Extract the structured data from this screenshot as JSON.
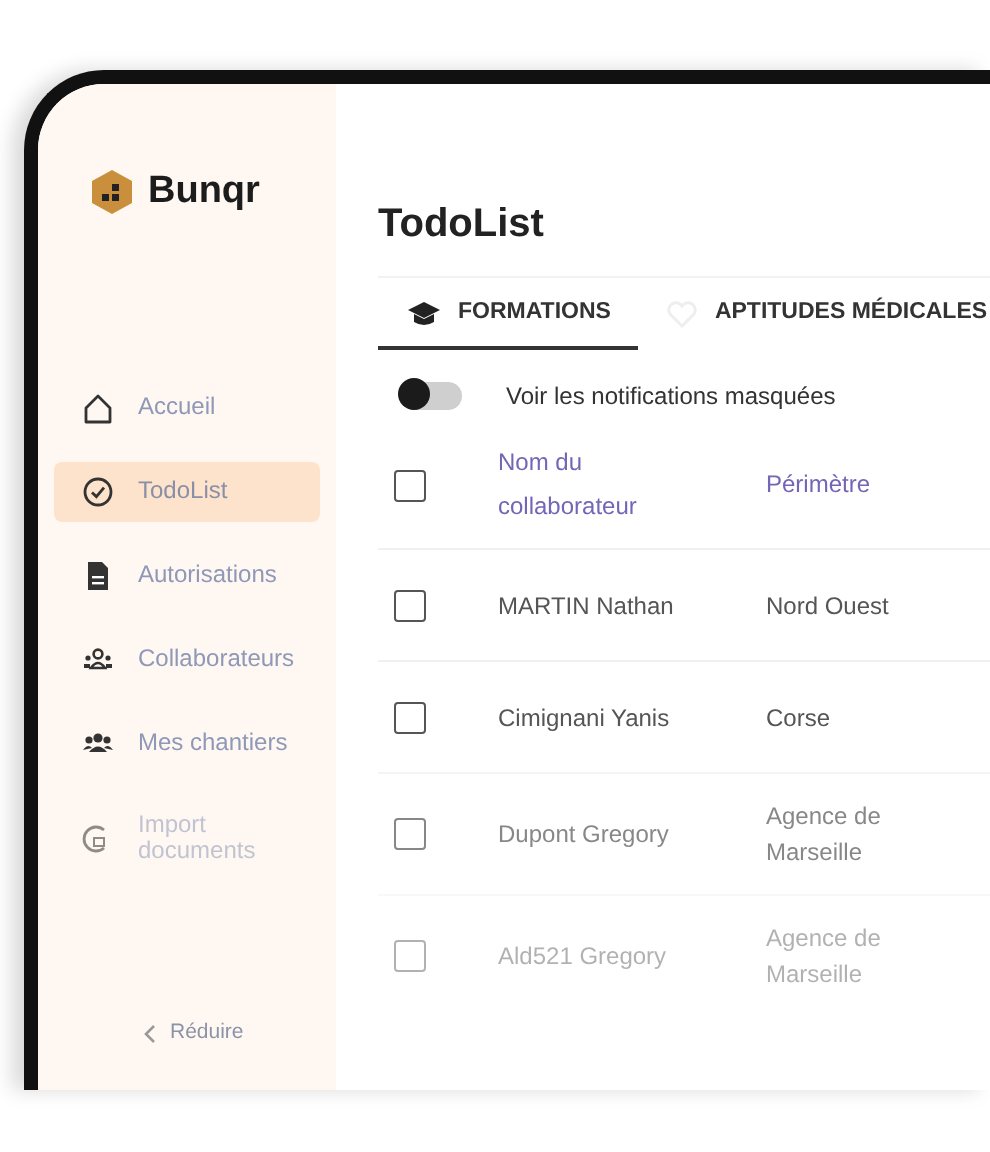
{
  "brand": {
    "name": "Bunqr"
  },
  "sidebar": {
    "items": [
      {
        "label": "Accueil",
        "kind": "home",
        "selected": false
      },
      {
        "label": "TodoList",
        "kind": "check",
        "selected": true
      },
      {
        "label": "Autorisations",
        "kind": "document",
        "selected": false
      },
      {
        "label": "Collaborateurs",
        "kind": "team",
        "selected": false
      },
      {
        "label": "Mes chantiers",
        "kind": "group",
        "selected": false
      },
      {
        "label": "Import documents",
        "kind": "import",
        "selected": false
      }
    ],
    "collapse": {
      "label": "Réduire"
    }
  },
  "page": {
    "title": "TodoList"
  },
  "tabs": [
    {
      "label": "FORMATIONS",
      "kind": "cap",
      "selected": true
    },
    {
      "label": "APTITUDES MÉDICALES",
      "kind": "heart",
      "selected": false
    }
  ],
  "toggle": {
    "label": "Voir les notifications masquées",
    "on": false
  },
  "table": {
    "columns": [
      "Nom du collaborateur",
      "Périmètre"
    ],
    "header_checked": false,
    "rows": [
      {
        "name": "MARTIN Nathan",
        "perimeter": "Nord Ouest",
        "checked": false
      },
      {
        "name": "Cimignani Yanis",
        "perimeter": "Corse",
        "checked": false
      },
      {
        "name": "Dupont Gregory",
        "perimeter": "Agence de Marseille",
        "checked": false
      },
      {
        "name": "Ald521 Gregory",
        "perimeter": "Agence de Marseille",
        "checked": false
      }
    ]
  }
}
